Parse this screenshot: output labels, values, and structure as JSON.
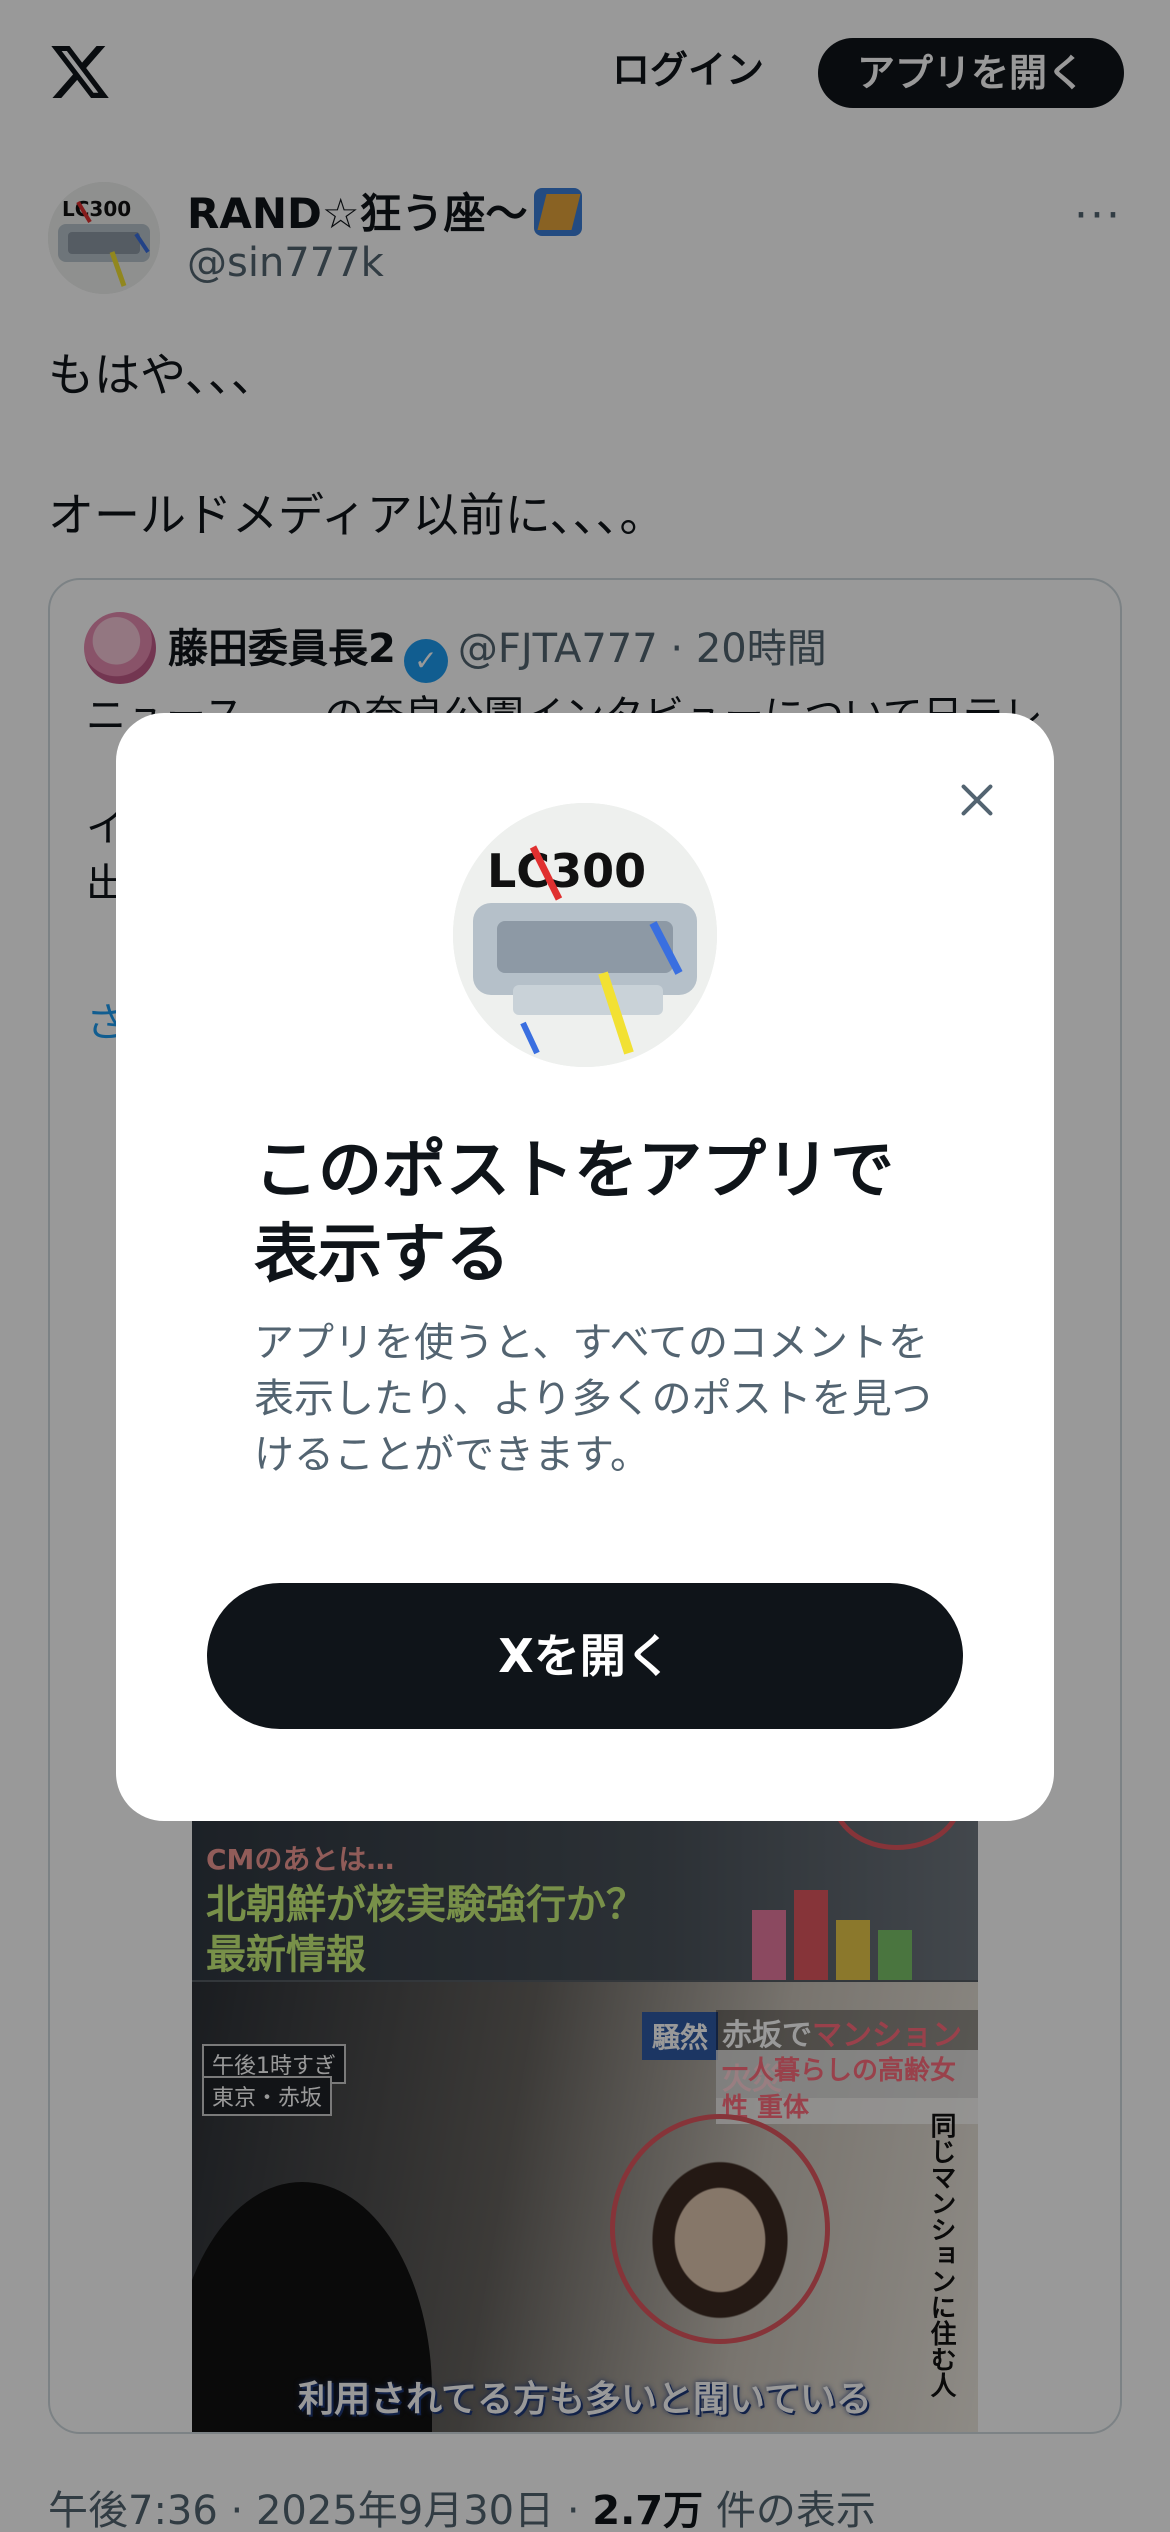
{
  "header": {
    "logo_icon": "x-logo-icon",
    "login_label": "ログイン",
    "open_app_label": "アプリを開く"
  },
  "post": {
    "author_name": "RAND☆狂う座〜",
    "author_handle": "@sin777k",
    "more_icon": "more-horizontal-icon",
    "more_label": "···",
    "text": "もはや､､､\n\nオールドメディア以前に､､､｡",
    "timestamp": "午後7:36 · 2025年9月30日 · ",
    "views_count": "2.7万",
    "views_label": " 件の表示"
  },
  "quote": {
    "author_name": "藤田委員長2",
    "verified_icon": "verified-badge-icon",
    "verified_glyph": "✓",
    "handle_time": "@FJTA777 · 20時間",
    "text_partial": "ニュース……の奈良公園インタビューについて日テレ\n\nイ\n出…",
    "more_link": "さ",
    "media": {
      "cm_label": "CMのあとは…",
      "headline_1": "北朝鮮が核実験強行か？",
      "headline_2": "最新情報",
      "time_label": "午後1時すぎ",
      "place_label": "東京・赤坂",
      "news_tag": "騒然",
      "news_1_pre": "赤坂で",
      "news_1_highlight": "マンション火災",
      "news_2": "一人暮らしの高齢女性 重体",
      "side_caption": "同じマンションに住む人",
      "subtitle": "利用されてる方も多いと聞いている"
    }
  },
  "modal": {
    "close_icon": "close-icon",
    "title": "このポストをアプリで表示する",
    "description": "アプリを使うと、すべてのコメントを表示したり、より多くのポストを見つけることができます。",
    "cta_label": "Xを開く"
  },
  "colors": {
    "accent": "#1d9bf0",
    "primary_button": "#0f1419",
    "secondary_text": "#536471",
    "overlay": "rgba(0,0,0,0.4)"
  }
}
